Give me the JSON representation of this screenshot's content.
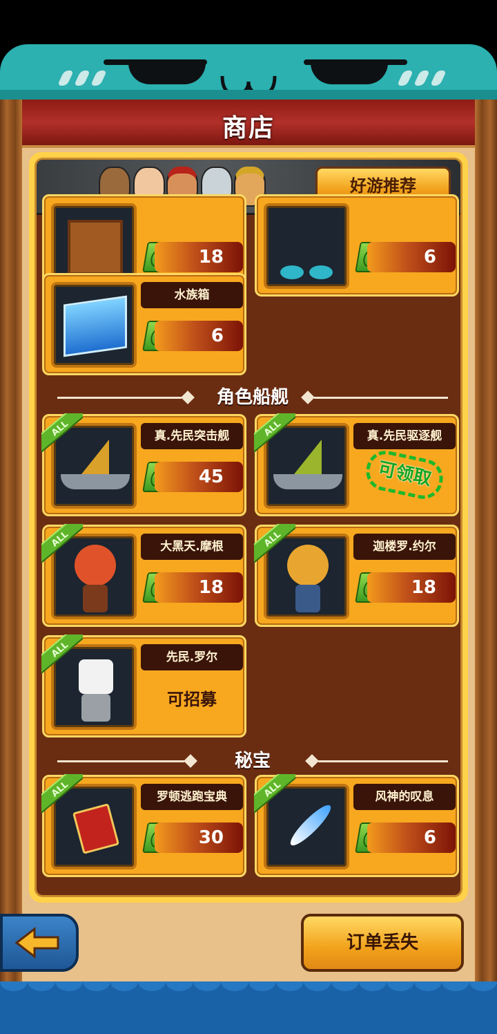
{
  "title": "商店",
  "recommend_label": "好游推荐",
  "sections": {
    "ships_title": "角色船舰",
    "treasure_title": "秘宝"
  },
  "top_cards": {
    "left_price": "18",
    "right_price": "6"
  },
  "items": {
    "water_box": {
      "name": "水族箱",
      "price": "6"
    },
    "ship_assault": {
      "name": "真.先民突击舰",
      "price": "45"
    },
    "ship_destroyer": {
      "name": "真.先民驱逐舰",
      "status": "可领取"
    },
    "morgan": {
      "name": "大黑天.摩根",
      "price": "18"
    },
    "john": {
      "name": "迦楼罗.约尔",
      "price": "18"
    },
    "rol": {
      "name": "先民.罗尔",
      "status": "可招募"
    },
    "escape_book": {
      "name": "罗顿逃跑宝典",
      "price": "30"
    },
    "wind_sigh": {
      "name": "风神的叹息",
      "price": "6"
    }
  },
  "tag_label": "ALL",
  "order_lost_label": "订单丢失",
  "colors": {
    "title_red": "#b2302a",
    "panel_gold": "#ffd24a",
    "card_orange": "#f7a81f",
    "teal": "#2cb0b0",
    "back_blue": "#1f5796"
  }
}
